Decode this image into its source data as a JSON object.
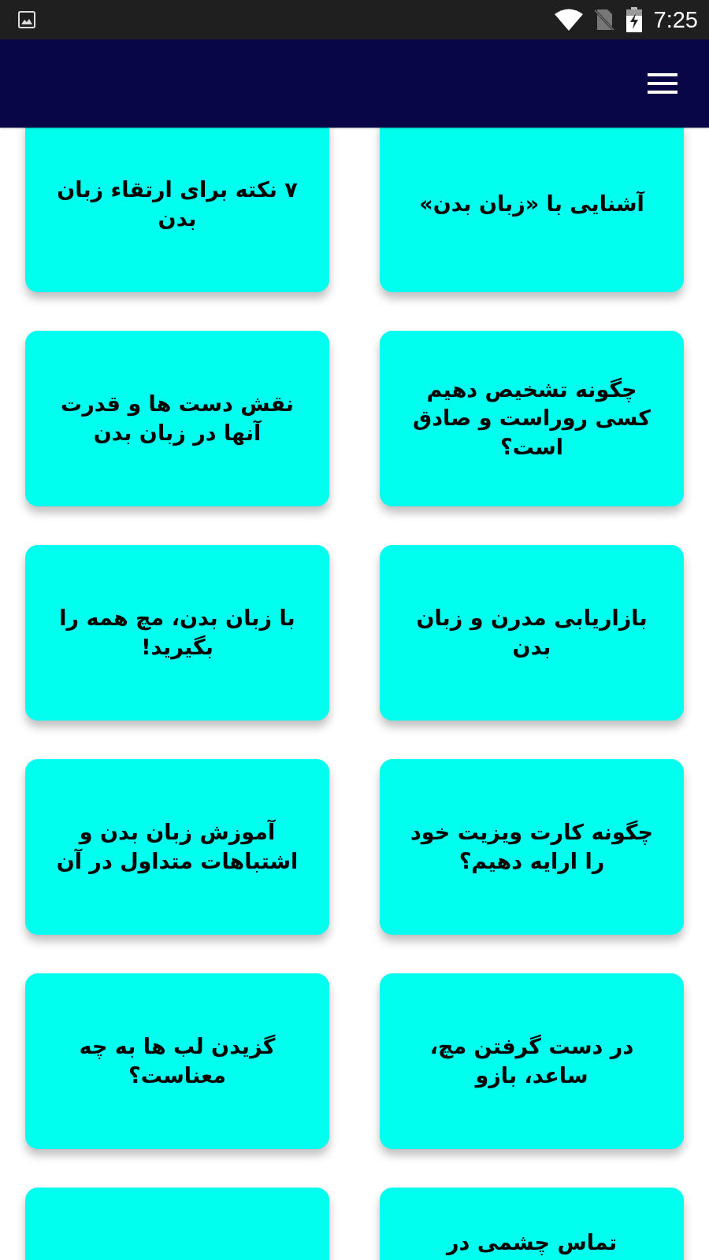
{
  "status_bar": {
    "time": "7:25"
  },
  "rows": [
    {
      "cards": [
        {
          "kind": "article",
          "title": "آشنایی با «زبان بدن»"
        },
        {
          "kind": "article",
          "title": "۷ نکته برای ارتقاء زبان بدن"
        }
      ]
    },
    {
      "cards": [
        {
          "kind": "article",
          "title": "چگونه تشخیص دهیم کسی روراست و صادق است؟"
        },
        {
          "kind": "article",
          "title": "نقش دست ها و قدرت آنها در زبان بدن"
        }
      ]
    },
    {
      "cards": [
        {
          "kind": "article",
          "title": "بازاریابی مدرن و زبان بدن"
        },
        {
          "kind": "article",
          "title": "با زبان بدن، مچ همه را بگیرید!"
        }
      ]
    },
    {
      "cards": [
        {
          "kind": "article",
          "title": "چگونه کارت ویزیت خود را ارایه دهیم؟"
        },
        {
          "kind": "article",
          "title": "آموزش زبان بدن و اشتباهات متداول در آن"
        }
      ]
    },
    {
      "cards": [
        {
          "kind": "article",
          "title": "در دست گرفتن مچ، ساعد، بازو"
        },
        {
          "kind": "article",
          "title": "گزیدن لب ها به چه معناست؟"
        }
      ]
    },
    {
      "cards": [
        {
          "kind": "article",
          "title": "تماس چشمی در"
        },
        {
          "kind": "blank"
        }
      ]
    }
  ]
}
